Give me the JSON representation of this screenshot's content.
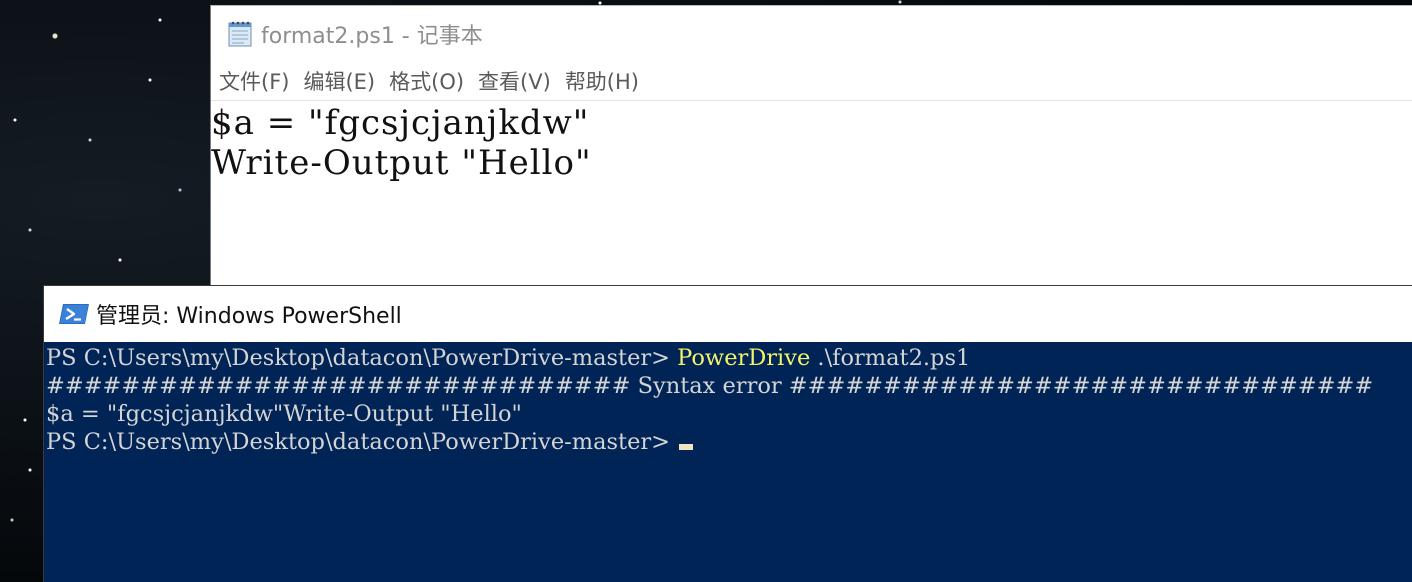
{
  "notepad": {
    "title": "format2.ps1 - 记事本",
    "icon": "notepad-icon",
    "menu": [
      {
        "label": "文件(F)"
      },
      {
        "label": "编辑(E)"
      },
      {
        "label": "格式(O)"
      },
      {
        "label": "查看(V)"
      },
      {
        "label": "帮助(H)"
      }
    ],
    "lines": [
      "$a = \"fgcsjcjanjkdw\"",
      "Write-Output \"Hello\""
    ]
  },
  "powershell": {
    "title": "管理员: Windows PowerShell",
    "icon": "powershell-icon",
    "lines": {
      "l1_prompt": "PS C:\\Users\\my\\Desktop\\datacon\\PowerDrive-master> ",
      "l1_command": "PowerDrive",
      "l1_args": " .\\format2.ps1",
      "l2": "############################### Syntax error ###############################",
      "l3": "$a = \"fgcsjcjanjkdw\"Write-Output \"Hello\"",
      "l4_prompt": "PS C:\\Users\\my\\Desktop\\datacon\\PowerDrive-master> "
    },
    "colors": {
      "background": "#012456",
      "text": "#d4d4d4",
      "command": "#f3f36b"
    }
  }
}
